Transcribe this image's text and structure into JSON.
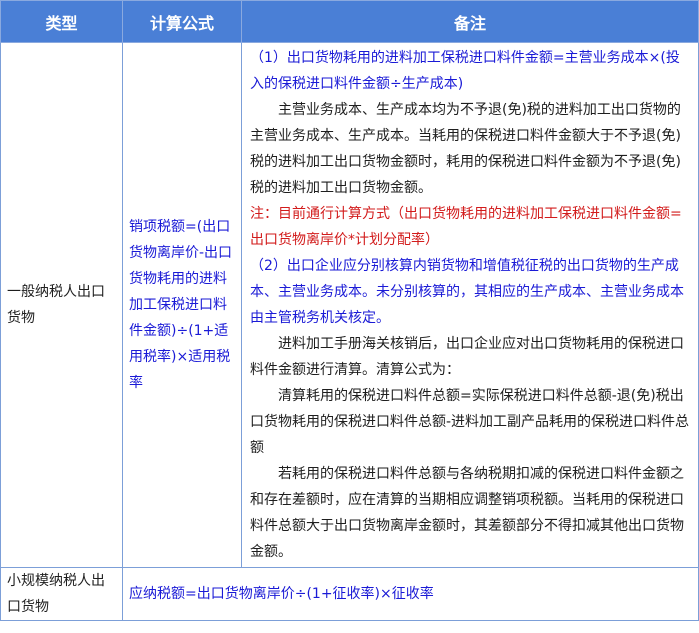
{
  "table": {
    "headers": [
      "类型",
      "计算公式",
      "备注"
    ],
    "row1": {
      "type": "一般纳税人出口货物",
      "formula": "销项税额=(出口货物离岸价-出口货物耗用的进料加工保税进口料件金额)÷(1+适用税率)×适用税率",
      "notes": {
        "n1": "（1）出口货物耗用的进料加工保税进口料件金额=主营业务成本×(投入的保税进口料件金额÷生产成本)",
        "p1": "主营业务成本、生产成本均为不予退(免)税的进料加工出口货物的主营业务成本、生产成本。当耗用的保税进口料件金额大于不予退(免)税的进料加工出口货物金额时，耗用的保税进口料件金额为不予退(免)税的进料加工出口货物金额。",
        "red": "注：目前通行计算方式（出口货物耗用的进料加工保税进口料件金额=出口货物离岸价*计划分配率）",
        "n2": "（2）出口企业应分别核算内销货物和增值税征税的出口货物的生产成本、主营业务成本。未分别核算的，其相应的生产成本、主营业务成本由主管税务机关核定。",
        "p2": "进料加工手册海关核销后，出口企业应对出口货物耗用的保税进口料件金额进行清算。清算公式为：",
        "p3": "清算耗用的保税进口料件总额=实际保税进口料件总额-退(免)税出口货物耗用的保税进口料件总额-进料加工副产品耗用的保税进口料件总额",
        "p4": "若耗用的保税进口料件总额与各纳税期扣减的保税进口料件金额之和存在差额时，应在清算的当期相应调整销项税额。当耗用的保税进口料件总额大于出口货物离岸金额时，其差额部分不得扣减其他出口货物金额。"
      }
    },
    "row2": {
      "type": "小规模纳税人出口货物",
      "formula": "应纳税额=出口货物离岸价÷(1+征收率)×征收率"
    }
  }
}
